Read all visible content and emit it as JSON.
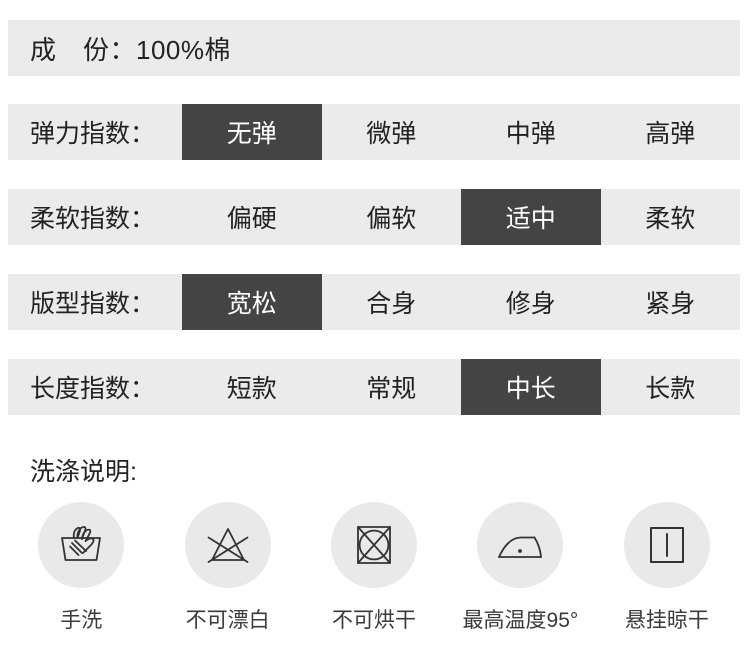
{
  "composition": {
    "label": "成　份：100%棉"
  },
  "indices": [
    {
      "name": "elastic",
      "label": "弹力指数：",
      "options": [
        {
          "text": "无弹",
          "selected": true
        },
        {
          "text": "微弹",
          "selected": false
        },
        {
          "text": "中弹",
          "selected": false
        },
        {
          "text": "高弹",
          "selected": false
        }
      ]
    },
    {
      "name": "softness",
      "label": "柔软指数：",
      "options": [
        {
          "text": "偏硬",
          "selected": false
        },
        {
          "text": "偏软",
          "selected": false
        },
        {
          "text": "适中",
          "selected": true
        },
        {
          "text": "柔软",
          "selected": false
        }
      ]
    },
    {
      "name": "fit",
      "label": "版型指数：",
      "options": [
        {
          "text": "宽松",
          "selected": true
        },
        {
          "text": "合身",
          "selected": false
        },
        {
          "text": "修身",
          "selected": false
        },
        {
          "text": "紧身",
          "selected": false
        }
      ]
    },
    {
      "name": "length",
      "label": "长度指数：",
      "options": [
        {
          "text": "短款",
          "selected": false
        },
        {
          "text": "常规",
          "selected": false
        },
        {
          "text": "中长",
          "selected": true
        },
        {
          "text": "长款",
          "selected": false
        }
      ]
    }
  ],
  "wash": {
    "title": "洗涤说明:",
    "items": [
      {
        "icon": "hand-wash-icon",
        "caption": "手洗"
      },
      {
        "icon": "do-not-bleach-icon",
        "caption": "不可漂白"
      },
      {
        "icon": "do-not-tumble-dry-icon",
        "caption": "不可烘干"
      },
      {
        "icon": "iron-low-heat-icon",
        "caption": "最高温度95°"
      },
      {
        "icon": "hang-to-dry-icon",
        "caption": "悬挂晾干"
      }
    ]
  },
  "colors": {
    "band_background": "#EBEBEB",
    "selected_background": "#444444",
    "selected_text": "#FFFFFF",
    "text": "#222222",
    "icon_circle": "#E9E9E9",
    "icon_stroke": "#333333",
    "page_background": "#FFFFFF"
  }
}
